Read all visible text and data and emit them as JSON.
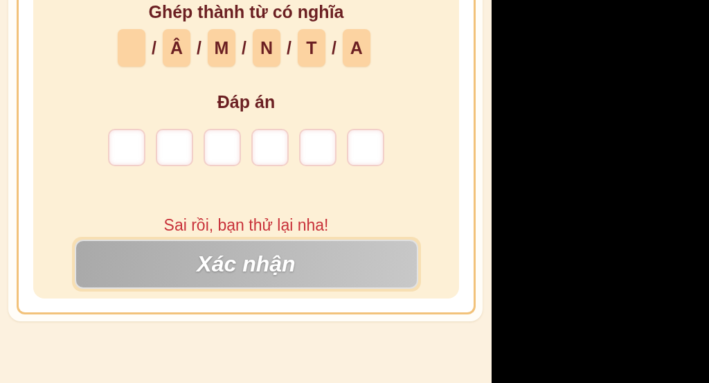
{
  "title": "Ghép thành từ có nghĩa",
  "tiles": [
    {
      "kind": "blank"
    },
    {
      "kind": "letter",
      "letter": "Â"
    },
    {
      "kind": "letter",
      "letter": "M"
    },
    {
      "kind": "letter",
      "letter": "N"
    },
    {
      "kind": "letter",
      "letter": "T"
    },
    {
      "kind": "letter",
      "letter": "A"
    }
  ],
  "separator": "/",
  "answer_label": "Đáp án",
  "answer_slots": [
    {
      "filled": false
    },
    {
      "filled": false
    },
    {
      "filled": false
    },
    {
      "filled": false
    },
    {
      "filled": false
    },
    {
      "filled": false
    }
  ],
  "message": "Sai rồi, bạn thử lại nha!",
  "confirm_button": {
    "label": "Xác nhận",
    "disabled": true
  }
}
